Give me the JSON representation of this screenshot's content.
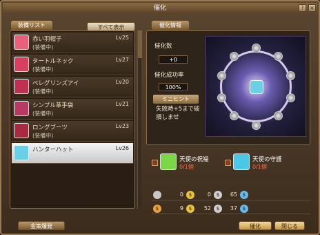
{
  "window": {
    "title": "催化"
  },
  "tabs": {
    "list": "装備リスト",
    "show_all": "すべて表示",
    "info": "催化情報"
  },
  "items": [
    {
      "name": "赤い羽帽子",
      "level": "Lv25",
      "status": "(装備中)",
      "color": "#e8607a"
    },
    {
      "name": "タートルネック",
      "level": "Lv27",
      "status": "(装備中)",
      "color": "#d84060"
    },
    {
      "name": "ペレグリンズアイ",
      "level": "Lv20",
      "status": "(装備中)",
      "color": "#c03050"
    },
    {
      "name": "シンプル革手袋",
      "level": "Lv21",
      "status": "(装備中)",
      "color": "#b83a60"
    },
    {
      "name": "ロングブーツ",
      "level": "Lv23",
      "status": "(装備中)",
      "color": "#a82a40"
    },
    {
      "name": "ハンターハット",
      "level": "Lv26",
      "status": "",
      "color": "#6ad0e8"
    }
  ],
  "info": {
    "count_label": "催化数",
    "count_value": "+0",
    "rate_label": "催化成功率",
    "rate_value": "100%",
    "mini_label": "ミニヒント",
    "mini_text": "失敗時+5まで破損しませ"
  },
  "buffs": [
    {
      "name": "天使の祝福",
      "count": "0/1個",
      "color": "#7ad848"
    },
    {
      "name": "天使の守護",
      "count": "0/1個",
      "color": "#4ac8e8"
    }
  ],
  "money": {
    "row1": [
      "0",
      "0",
      "65"
    ],
    "row2": [
      "9",
      "52",
      "37"
    ]
  },
  "buttons": {
    "register": "金策爆発",
    "charm": "催化",
    "close": "閉じる"
  }
}
